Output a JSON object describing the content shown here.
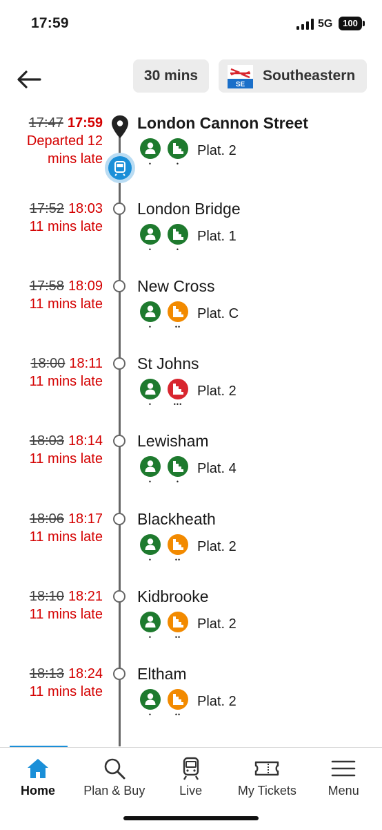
{
  "status_bar": {
    "time": "17:59",
    "network": "5G",
    "battery": "100"
  },
  "header": {
    "duration": "30 mins",
    "operator": "Southeastern",
    "operator_logo_text": "SE"
  },
  "stops": [
    {
      "scheduled": "17:47",
      "expected": "17:59",
      "status": "Departed 12 mins late",
      "name": "London Cannon Street",
      "platform": "Plat. 2",
      "step_level": 1,
      "current": true
    },
    {
      "scheduled": "17:52",
      "expected": "18:03",
      "status": "11 mins late",
      "name": "London Bridge",
      "platform": "Plat. 1",
      "step_level": 1
    },
    {
      "scheduled": "17:58",
      "expected": "18:09",
      "status": "11 mins late",
      "name": "New Cross",
      "platform": "Plat. C",
      "step_level": 2
    },
    {
      "scheduled": "18:00",
      "expected": "18:11",
      "status": "11 mins late",
      "name": "St Johns",
      "platform": "Plat. 2",
      "step_level": 3
    },
    {
      "scheduled": "18:03",
      "expected": "18:14",
      "status": "11 mins late",
      "name": "Lewisham",
      "platform": "Plat. 4",
      "step_level": 1
    },
    {
      "scheduled": "18:06",
      "expected": "18:17",
      "status": "11 mins late",
      "name": "Blackheath",
      "platform": "Plat. 2",
      "step_level": 2
    },
    {
      "scheduled": "18:10",
      "expected": "18:21",
      "status": "11 mins late",
      "name": "Kidbrooke",
      "platform": "Plat. 2",
      "step_level": 2
    },
    {
      "scheduled": "18:13",
      "expected": "18:24",
      "status": "11 mins late",
      "name": "Eltham",
      "platform": "Plat. 2",
      "step_level": 2
    }
  ],
  "nav": [
    {
      "label": "Home",
      "icon": "home-icon",
      "active": true
    },
    {
      "label": "Plan & Buy",
      "icon": "search-icon"
    },
    {
      "label": "Live",
      "icon": "train-icon"
    },
    {
      "label": "My Tickets",
      "icon": "ticket-icon"
    },
    {
      "label": "Menu",
      "icon": "menu-icon"
    }
  ],
  "colors": {
    "late": "#d40000",
    "step_level_1": "#1e7a2e",
    "step_level_2": "#f28a00",
    "step_level_3": "#d8262f",
    "accent": "#1a8fd8"
  }
}
